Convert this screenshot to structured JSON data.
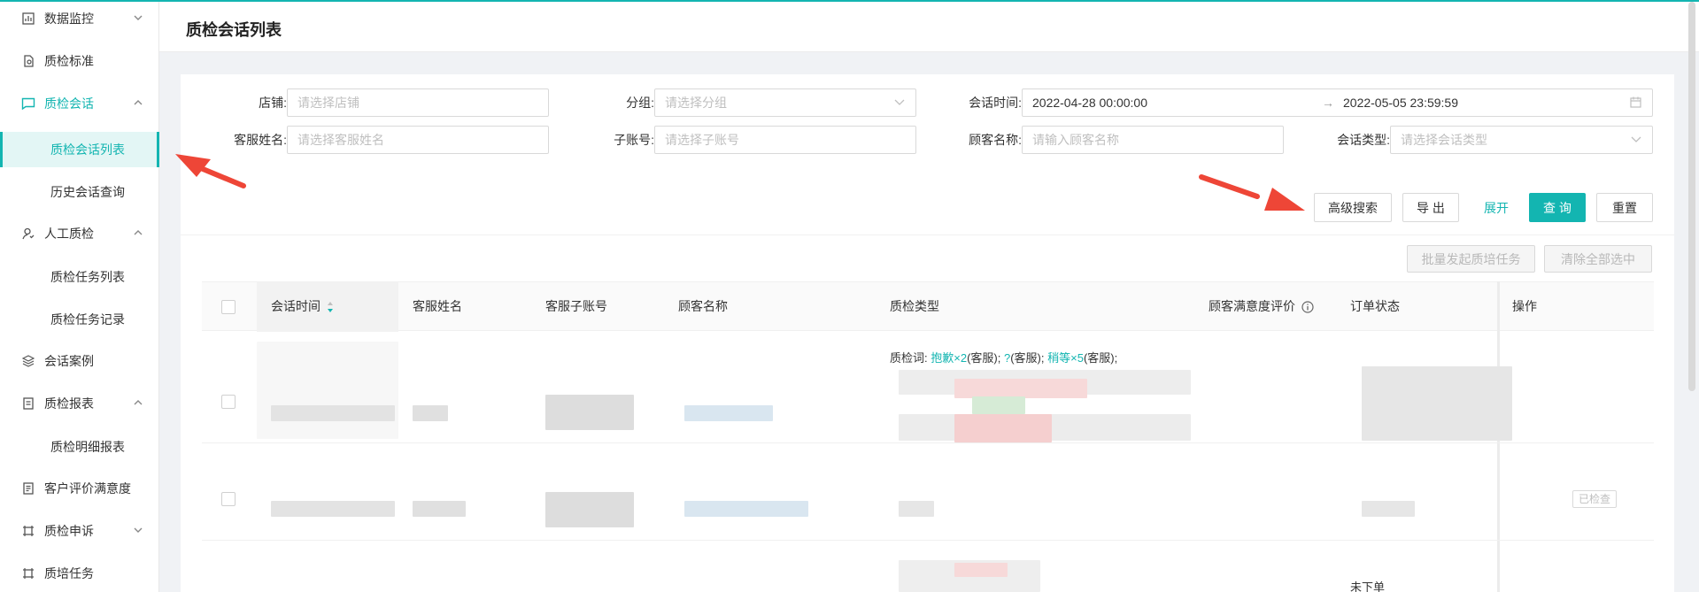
{
  "sidebar": {
    "items": [
      {
        "label": "数据监控",
        "icon": "chart-icon"
      },
      {
        "label": "质检标准",
        "icon": "document-icon"
      },
      {
        "label": "质检会话",
        "icon": "message-icon"
      },
      {
        "label": "质检会话列表"
      },
      {
        "label": "历史会话查询"
      },
      {
        "label": "人工质检",
        "icon": "user-icon"
      },
      {
        "label": "质检任务列表"
      },
      {
        "label": "质检任务记录"
      },
      {
        "label": "会话案例",
        "icon": "layers-icon"
      },
      {
        "label": "质检报表",
        "icon": "report-icon"
      },
      {
        "label": "质检明细报表"
      },
      {
        "label": "客户评价满意度",
        "icon": "list-icon"
      },
      {
        "label": "质检申诉",
        "icon": "frame-icon"
      },
      {
        "label": "质培任务",
        "icon": "frame-icon"
      }
    ],
    "selected": "质检会话列表",
    "accent": "#13b5b1"
  },
  "header": {
    "title": "质检会话列表"
  },
  "filters": {
    "shop": {
      "label": "店铺:",
      "placeholder": "请选择店铺"
    },
    "group": {
      "label": "分组:",
      "placeholder": "请选择分组"
    },
    "session_time": {
      "label": "会话时间:",
      "start": "2022-04-28 00:00:00",
      "separator": "→",
      "end": "2022-05-05 23:59:59"
    },
    "agent_name": {
      "label": "客服姓名:",
      "placeholder": "请选择客服姓名"
    },
    "sub_account": {
      "label": "子账号:",
      "placeholder": "请选择子账号"
    },
    "customer_name": {
      "label": "顾客名称:",
      "placeholder": "请输入顾客名称"
    },
    "session_type": {
      "label": "会话类型:",
      "placeholder": "请选择会话类型"
    }
  },
  "actions": {
    "advanced_search": "高级搜索",
    "export": "导 出",
    "expand": "展开",
    "query": "查 询",
    "reset": "重置",
    "batch_training": "批量发起质培任务",
    "clear_selection": "清除全部选中"
  },
  "table": {
    "columns": [
      "会话时间",
      "客服姓名",
      "客服子账号",
      "顾客名称",
      "质检类型",
      "顾客满意度评价",
      "订单状态",
      "操作"
    ],
    "rows": [
      {
        "quality_prefix": "质检词:",
        "terms": [
          {
            "word": "抱歉×2",
            "role": "(客服);"
          },
          {
            "word": "?",
            "role": "(客服);"
          },
          {
            "word": "稍等×5",
            "role": "(客服);"
          }
        ]
      },
      {
        "badge": "已检查"
      },
      {
        "order_status": "未下单"
      }
    ]
  }
}
